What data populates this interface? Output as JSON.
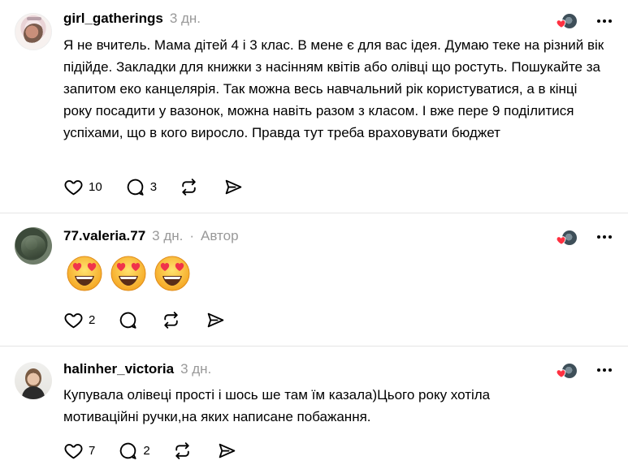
{
  "comments": [
    {
      "username": "girl_gatherings",
      "time": "3 дн.",
      "author_tag": "",
      "text": "Я не вчитель. Мама дітей 4 і 3 клас. В мене є для вас ідея. Думаю теке на різний вік підійде. Закладки для книжки з насінням квітів або олівці що ростуть. Пошукайте за запитом еко канцелярія. Так можна весь навчальний рік користуватися, а в кінці року посадити у вазонок, можна навіть разом з класом. І вже пере 9 поділитися успіхами, що в кого виросло. Правда тут треба враховувати бюджет",
      "likes": "10",
      "replies": "3"
    },
    {
      "username": "77.valeria.77",
      "time": "3 дн.",
      "separator": "·",
      "author_tag": "Автор",
      "emoji_count": 3,
      "emoji_name": "smiling-face-with-heart-eyes",
      "likes": "2",
      "replies": ""
    },
    {
      "username": "halinher_victoria",
      "time": "3 дн.",
      "author_tag": "",
      "text": "Купувала олівеці прості і шось ше там їм казала)Цього року хотіла мотиваційні ручки,на яких написане побажання.",
      "likes": "7",
      "replies": "2"
    }
  ],
  "colors": {
    "accent_heart": "#ff3040",
    "muted_text": "#999999",
    "divider": "#e5e5e5"
  }
}
